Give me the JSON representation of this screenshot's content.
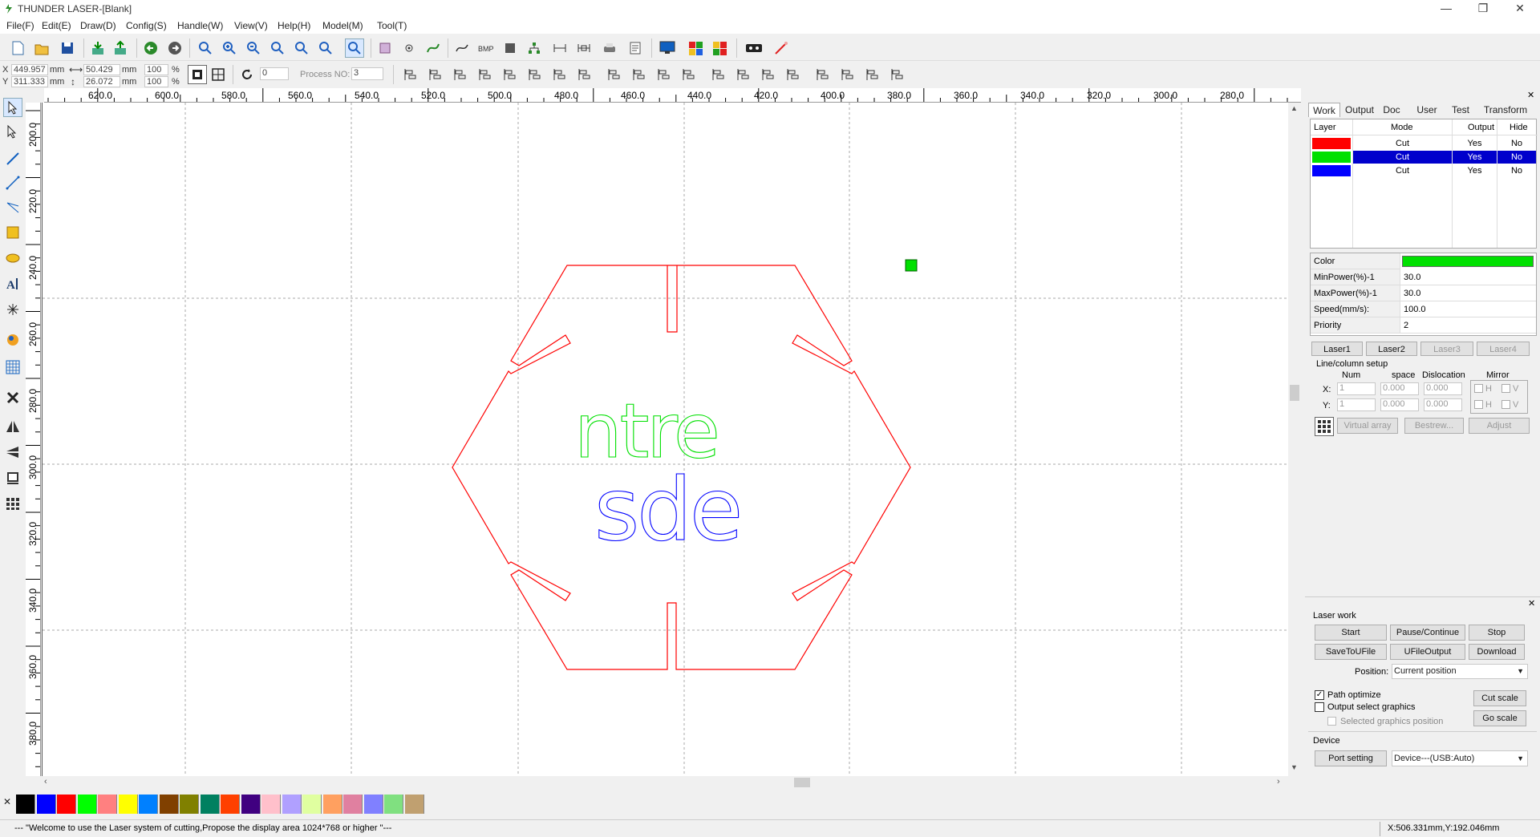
{
  "window": {
    "title": "THUNDER LASER-[Blank]",
    "btn_min": "—",
    "btn_max": "❐",
    "btn_close": "✕"
  },
  "menu": [
    "File(F)",
    "Edit(E)",
    "Draw(D)",
    "Config(S)",
    "Handle(W)",
    "View(V)",
    "Help(H)",
    "Model(M)",
    "Tool(T)"
  ],
  "coords": {
    "x_label": "X",
    "x_value": "449.957",
    "y_label": "Y",
    "y_value": "311.333",
    "unit_mm": "mm",
    "width_value": "50.429",
    "height_value": "26.072",
    "scale_x": "100",
    "scale_y": "100",
    "pct": "%",
    "rotate_value": "0",
    "process_no_label": "Process NO:",
    "process_no_value": "3"
  },
  "hruler": [
    "620.0",
    "600.0",
    "580.0",
    "560.0",
    "540.0",
    "520.0",
    "500.0",
    "480.0",
    "460.0",
    "440.0",
    "420.0",
    "400.0",
    "380.0",
    "360.0",
    "340.0",
    "320.0",
    "300.0",
    "280.0"
  ],
  "vruler": [
    "200.0",
    "220.0",
    "240.0",
    "260.0",
    "280.0",
    "300.0",
    "320.0",
    "340.0",
    "360.0",
    "380.0"
  ],
  "canvas_text": {
    "line1": "ntre",
    "line2": "sde"
  },
  "colors": {
    "layer_red": "#ff0000",
    "layer_green": "#00e000",
    "layer_blue": "#0000ff",
    "selection": "#0000cc"
  },
  "palette": [
    "#000000",
    "#0000ff",
    "#ff0000",
    "#00ff00",
    "#ff8080",
    "#ffff00",
    "#0080ff",
    "#804000",
    "#808000",
    "#008060",
    "#ff4000",
    "#400080",
    "#ffc0cb",
    "#b0a0ff",
    "#e0ffa0",
    "#ffa060",
    "#e080a0",
    "#8080ff",
    "#80e080",
    "#c0a070"
  ],
  "panel": {
    "tabs": [
      "Work",
      "Output",
      "Doc",
      "User",
      "Test",
      "Transform"
    ],
    "layer_headers": [
      "Layer",
      "Mode",
      "Output",
      "Hide"
    ],
    "layers": [
      {
        "color": "#ff0000",
        "mode": "Cut",
        "output": "Yes",
        "hide": "No",
        "selected": false
      },
      {
        "color": "#00e000",
        "mode": "Cut",
        "output": "Yes",
        "hide": "No",
        "selected": true
      },
      {
        "color": "#0000ff",
        "mode": "Cut",
        "output": "Yes",
        "hide": "No",
        "selected": false
      }
    ],
    "props": [
      {
        "label": "Color",
        "value": ""
      },
      {
        "label": "MinPower(%)-1",
        "value": "30.0"
      },
      {
        "label": "MaxPower(%)-1",
        "value": "30.0"
      },
      {
        "label": "Speed(mm/s):",
        "value": "100.0"
      },
      {
        "label": "Priority",
        "value": "2"
      }
    ],
    "laser_tabs": [
      "Laser1",
      "Laser2",
      "Laser3",
      "Laser4"
    ],
    "array": {
      "title": "Line/column setup",
      "h_num": "Num",
      "h_space": "space",
      "h_dislocation": "Dislocation",
      "h_mirror": "Mirror",
      "x_label": "X:",
      "y_label": "Y:",
      "x_num": "1",
      "x_space": "0.000",
      "x_disl": "0.000",
      "y_num": "1",
      "y_space": "0.000",
      "y_disl": "0.000",
      "mirror_h": "H",
      "mirror_v": "V",
      "btn_virtual": "Virtual array",
      "btn_bestrew": "Bestrew...",
      "btn_adjust": "Adjust"
    }
  },
  "laserwork": {
    "title": "Laser work",
    "start": "Start",
    "pause": "Pause/Continue",
    "stop": "Stop",
    "save_ufile": "SaveToUFile",
    "ufile_output": "UFileOutput",
    "download": "Download",
    "position_label": "Position:",
    "position_value": "Current position",
    "path_optimize": "Path optimize",
    "output_select": "Output select graphics",
    "selected_pos": "Selected graphics position",
    "cut_scale": "Cut scale",
    "go_scale": "Go scale",
    "device_title": "Device",
    "port_setting": "Port setting",
    "device_value": "Device---(USB:Auto)"
  },
  "status": {
    "message": "--- \"Welcome to use the Laser system of cutting,Propose the display area 1024*768 or higher \"---",
    "coords": "X:506.331mm,Y:192.046mm"
  }
}
